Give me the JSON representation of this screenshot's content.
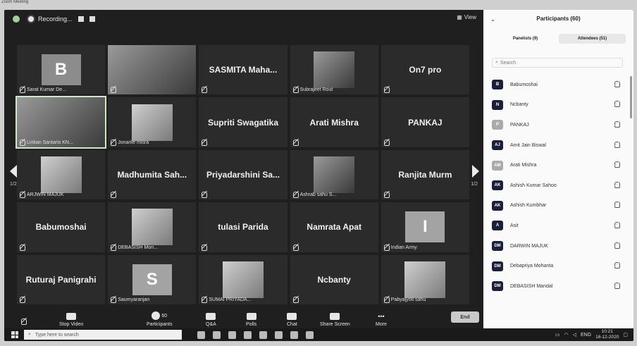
{
  "window": {
    "title": "Zoom Meeting"
  },
  "topbar": {
    "recording_label": "Recording...",
    "view_label": "View"
  },
  "grid": {
    "page_left": "1/2",
    "page_right": "1/2",
    "tiles": [
      {
        "type": "avatar",
        "letter": "B",
        "caption": "Sarat Kumar De..."
      },
      {
        "type": "photo",
        "caption": ""
      },
      {
        "type": "name",
        "name": "SASMITA Maha...",
        "caption": ""
      },
      {
        "type": "photo",
        "caption": "Subrajeet Rout"
      },
      {
        "type": "name",
        "name": "On7 pro",
        "caption": ""
      },
      {
        "type": "photo",
        "caption": "Linkan Santaris KN...",
        "active": true
      },
      {
        "type": "photo",
        "caption": "Jonarite misra"
      },
      {
        "type": "name",
        "name": "Supriti Swagatika",
        "caption": ""
      },
      {
        "type": "name",
        "name": "Arati Mishra",
        "caption": ""
      },
      {
        "type": "name",
        "name": "PANKAJ",
        "caption": ""
      },
      {
        "type": "photo",
        "caption": "ARJWIN MAJUK"
      },
      {
        "type": "name",
        "name": "Madhumita Sah...",
        "caption": ""
      },
      {
        "type": "name",
        "name": "Priyadarshini Sa...",
        "caption": ""
      },
      {
        "type": "photo",
        "caption": "Ashrab sahu S..."
      },
      {
        "type": "name",
        "name": "Ranjita Murm",
        "caption": ""
      },
      {
        "type": "name",
        "name": "Babumoshai",
        "caption": ""
      },
      {
        "type": "photo",
        "caption": "DEBASISH Mon..."
      },
      {
        "type": "name",
        "name": "tulasi Parida",
        "caption": ""
      },
      {
        "type": "name",
        "name": "Namrata Apat",
        "caption": ""
      },
      {
        "type": "avatar",
        "letter": "I",
        "caption": "Indian Army"
      },
      {
        "type": "name",
        "name": "Ruturaj Panigrahi",
        "caption": ""
      },
      {
        "type": "avatar",
        "letter": "S",
        "caption": "Saumyaranjan"
      },
      {
        "type": "photo",
        "caption": "SUMAI PRIYADA..."
      },
      {
        "type": "name",
        "name": "Ncbanty",
        "caption": ""
      },
      {
        "type": "photo",
        "caption": "Pabyajyoti sahu"
      }
    ]
  },
  "toolbar": {
    "unmute_label": "",
    "video_label": "Stop Video",
    "participants_label": "Participants",
    "participants_count": "60",
    "qa_label": "Q&A",
    "polls_label": "Polls",
    "chat_label": "Chat",
    "share_label": "Share Screen",
    "more_label": "More",
    "end_label": "End"
  },
  "panel": {
    "title": "Participants (60)",
    "tab_panelists": "Panelists (9)",
    "tab_attendees": "Attendees (51)",
    "search_placeholder": "Search",
    "participants": [
      {
        "initials": "B",
        "name": "Babumoshai",
        "style": "dark"
      },
      {
        "initials": "N",
        "name": "Ncbanty",
        "style": "dark"
      },
      {
        "initials": "P",
        "name": "PANKAJ",
        "style": "light"
      },
      {
        "initials": "AJ",
        "name": "Amit Jain Biswal",
        "style": "dark"
      },
      {
        "initials": "AM",
        "name": "Arati Mishra",
        "style": "light"
      },
      {
        "initials": "AK",
        "name": "Ashish Kumar Sahoo",
        "style": "dark"
      },
      {
        "initials": "AK",
        "name": "Ashish Kumbhar",
        "style": "dark"
      },
      {
        "initials": "A",
        "name": "Asit",
        "style": "dark"
      },
      {
        "initials": "DM",
        "name": "DARWIN MAJUK",
        "style": "dark"
      },
      {
        "initials": "DM",
        "name": "Debapriya Mohanta",
        "style": "dark"
      },
      {
        "initials": "DM",
        "name": "DEBASISH Mandal",
        "style": "dark"
      }
    ]
  },
  "taskbar": {
    "search_placeholder": "Type here to search",
    "lang": "ENG",
    "time": "10:21",
    "date": "16-12-2020"
  }
}
